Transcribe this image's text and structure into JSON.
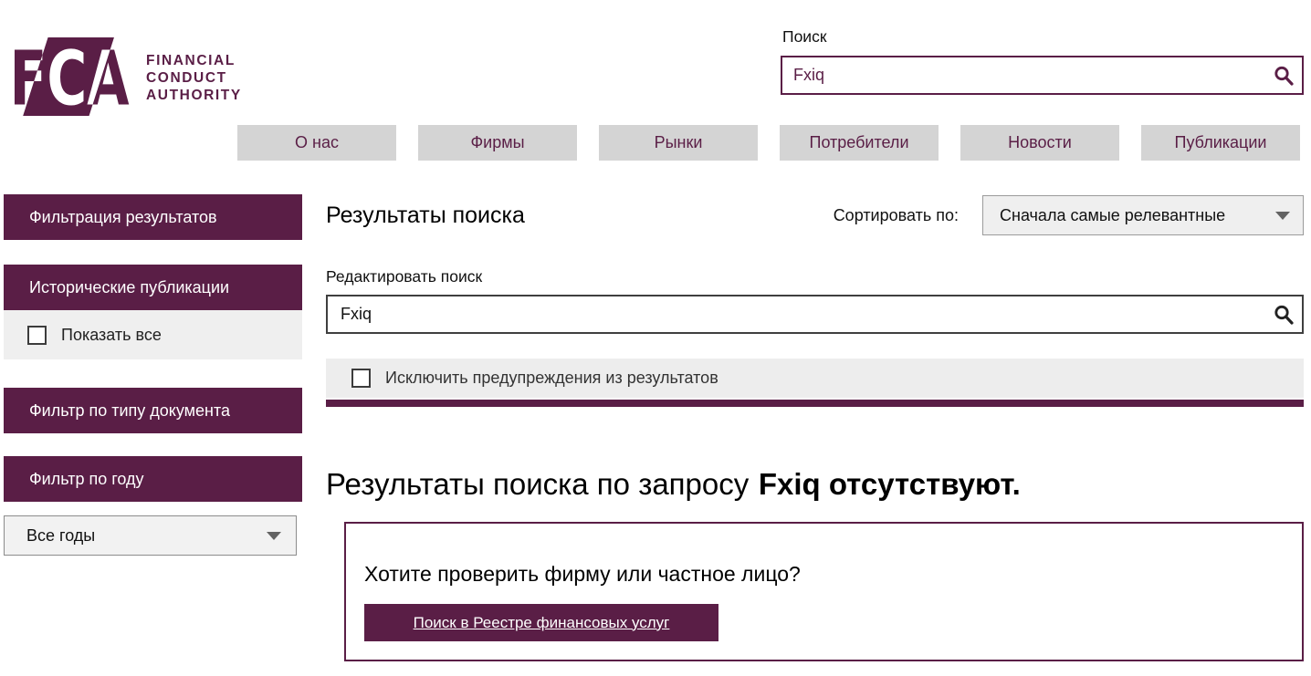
{
  "brand": {
    "logo_text": "FCA",
    "line1": "FINANCIAL",
    "line2": "CONDUCT",
    "line3": "AUTHORITY"
  },
  "header_search": {
    "label": "Поиск",
    "value": "Fxiq"
  },
  "nav": {
    "items": [
      "О нас",
      "Фирмы",
      "Рынки",
      "Потребители",
      "Новости",
      "Публикации"
    ]
  },
  "sidebar": {
    "filter_results": "Фильтрация результатов",
    "historical_publications": "Исторические публикации",
    "show_all": "Показать все",
    "filter_doc_type": "Фильтр по типу документа",
    "filter_year": "Фильтр по году",
    "year_value": "Все годы"
  },
  "main": {
    "title": "Результаты поиска",
    "sort_label": "Сортировать по:",
    "sort_value": "Сначала самые релевантные",
    "edit_search_label": "Редактировать поиск",
    "edit_search_value": "Fxiq",
    "exclude_warnings": "Исключить предупреждения из результатов",
    "no_results_prefix": "Результаты поиска по запросу",
    "no_results_emphasis": "Fxiq отсутствуют.",
    "prompt": "Хотите проверить фирму или частное лицо?",
    "register_button": "Поиск в Реестре финансовых услуг"
  },
  "colors": {
    "brand_maroon": "#5a1e46",
    "nav_gray": "#d4d4d4",
    "light_gray": "#efefef"
  }
}
